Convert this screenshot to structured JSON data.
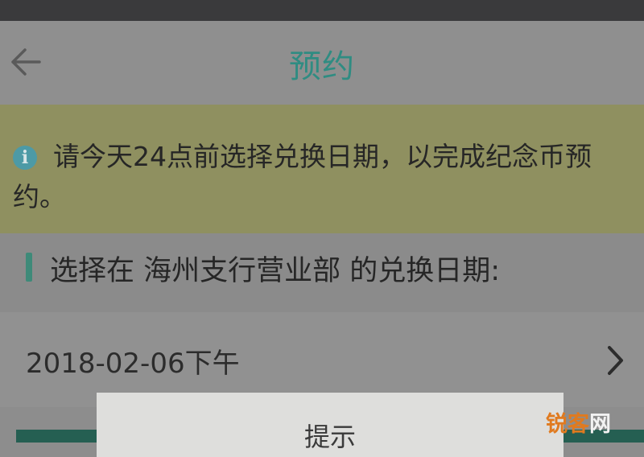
{
  "nav": {
    "title": "预约",
    "back_icon": "arrow-left-icon"
  },
  "notice": {
    "icon": "info-icon",
    "icon_glyph": "i",
    "text": "请今天24点前选择兑换日期，以完成纪念币预约。"
  },
  "section": {
    "label": "选择在 海州支行营业部 的兑换日期:"
  },
  "date_row": {
    "value": "2018-02-06下午",
    "icon": "chevron-right-icon"
  },
  "dialog": {
    "title": "提示"
  },
  "watermark": {
    "part1": "锐客",
    "part2": "网"
  },
  "colors": {
    "accent": "#2f8c82",
    "notice_bg": "#8f9060",
    "overlay_bg": "#8d8d8d"
  }
}
